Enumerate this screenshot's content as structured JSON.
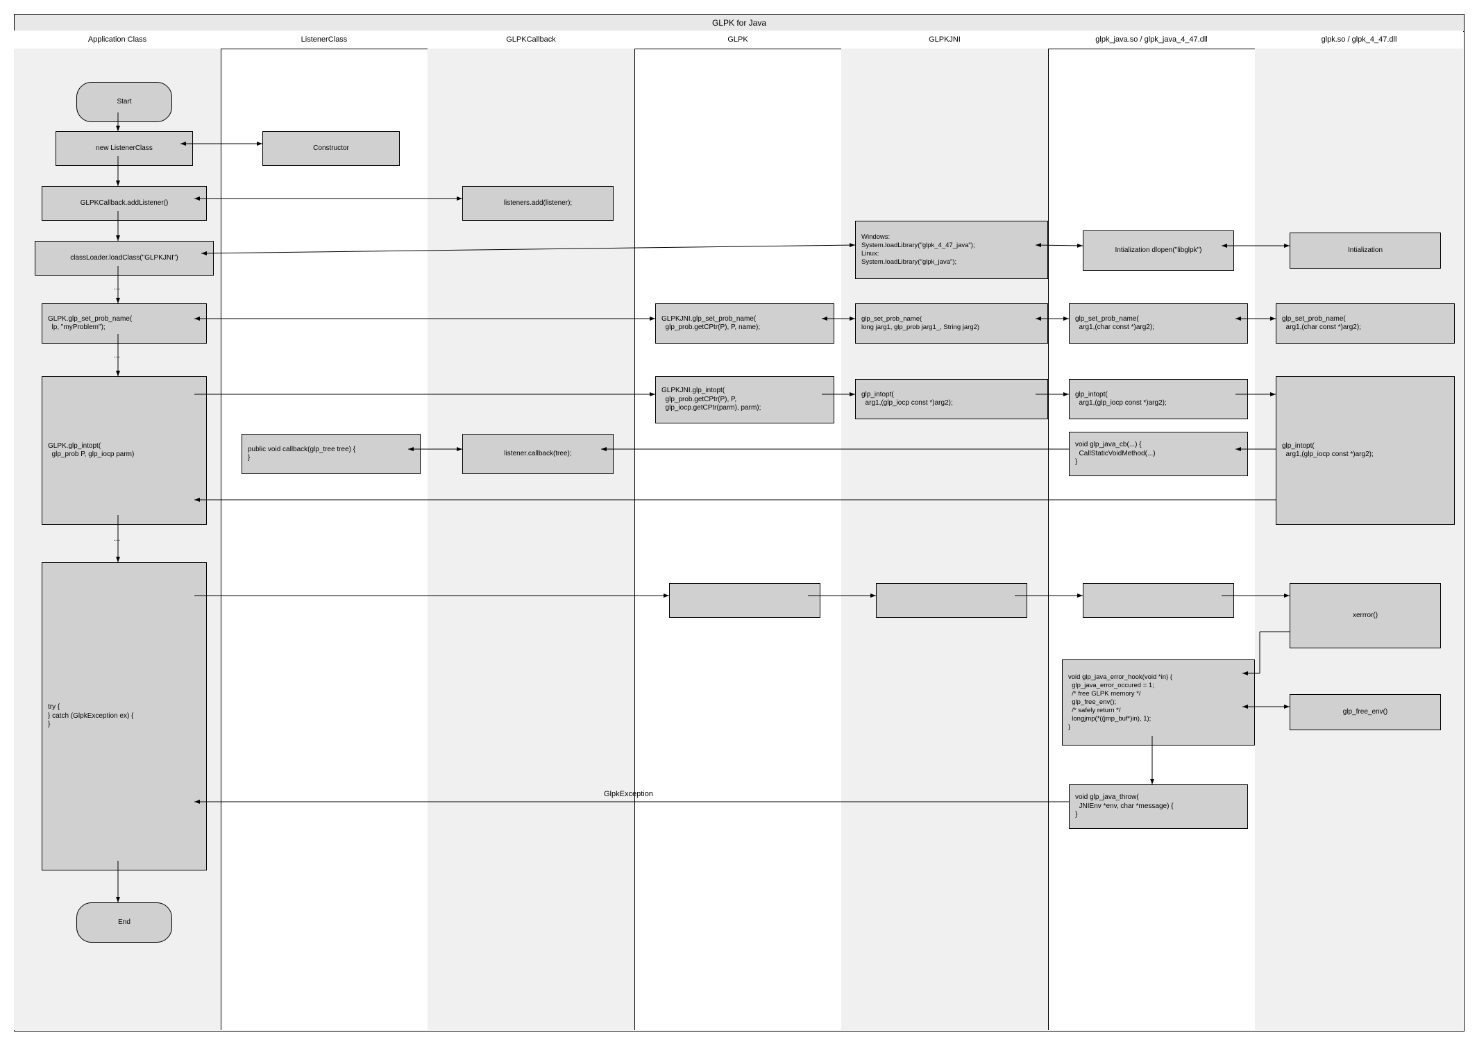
{
  "title": "GLPK for Java",
  "lanes": [
    "Application Class",
    "ListenerClass",
    "GLPKCallback",
    "GLPK",
    "GLPKJNI",
    "glpk_java.so / glpk_java_4_47.dll",
    "glpk.so / glpk_4_47.dll"
  ],
  "nodes": {
    "start": "Start",
    "newListener": "new ListenerClass",
    "constructor": "Constructor",
    "addListener": "GLPKCallback.addListener()",
    "listenersAdd": "listeners.add(listener);",
    "loadClass": "classLoader.loadClass(\"GLPKJNI\")",
    "jniLoad": "Windows:\nSystem.loadLibrary(\"glpk_4_47_java\");\nLinux:\nSystem.loadLibrary(\"glpk_java\");",
    "initA": "Intialization\ndlopen(\"libglpk\")",
    "initB": "Intialization",
    "setProbApp": "GLPK.glp_set_prob_name(\n  lp, \"myProblem\");",
    "setProbGlpk": "GLPKJNI.glp_set_prob_name(\n  glp_prob.getCPtr(P), P, name);",
    "setProbJni": "glp_set_prob_name(\nlong jarg1, glp_prob jarg1_, String jarg2)",
    "setProbSoA": "glp_set_prob_name(\n  arg1,(char const *)arg2);",
    "setProbSoB": "glp_set_prob_name(\n  arg1,(char const *)arg2);",
    "intoptApp": "GLPK.glp_intopt(\n  glp_prob P, glp_iocp parm)",
    "intoptGlpk": "GLPKJNI.glp_intopt(\n  glp_prob.getCPtr(P), P,\n  glp_iocp.getCPtr(parm), parm);",
    "intoptJni": "glp_intopt(\n  arg1,(glp_iocp const *)arg2);",
    "intoptSoA": "glp_intopt(\n  arg1,(glp_iocp const *)arg2);",
    "intoptSoB": "glp_intopt(\n  arg1,(glp_iocp const *)arg2);",
    "listenerCb": "public void callback(glp_tree tree) {\n}",
    "callbackCb": "listener.callback(tree);",
    "javaCb": "void glp_java_cb(...) {\n  CallStaticVoidMethod(...)\n}",
    "tryCatch": "try {\n} catch (GlpkException ex) {\n}",
    "xerror": "xerrror()",
    "errorHook": "void glp_java_error_hook(void *in) {\n  glp_java_error_occured = 1;\n  /* free GLPK memory */\n  glp_free_env();\n  /* safely return */\n  longjmp(*((jmp_buf*)in), 1);\n}",
    "freeEnv": "glp_free_env()",
    "javaThrow": "void glp_java_throw(\n  JNIEnv *env, char *message) {\n}",
    "end": "End",
    "dots": "...",
    "glpkException": "GlpkException"
  },
  "chart_data": {
    "type": "swimlane-flowchart",
    "title": "GLPK for Java",
    "lanes": [
      "Application Class",
      "ListenerClass",
      "GLPKCallback",
      "GLPK",
      "GLPKJNI",
      "glpk_java.so / glpk_java_4_47.dll",
      "glpk.so / glpk_4_47.dll"
    ],
    "nodes": [
      {
        "id": "start",
        "lane": 0,
        "kind": "terminator",
        "text": "Start"
      },
      {
        "id": "newListener",
        "lane": 0,
        "kind": "process",
        "text": "new ListenerClass"
      },
      {
        "id": "constructor",
        "lane": 1,
        "kind": "process",
        "text": "Constructor"
      },
      {
        "id": "addListener",
        "lane": 0,
        "kind": "process",
        "text": "GLPKCallback.addListener()"
      },
      {
        "id": "listenersAdd",
        "lane": 2,
        "kind": "process",
        "text": "listeners.add(listener);"
      },
      {
        "id": "loadClass",
        "lane": 0,
        "kind": "process",
        "text": "classLoader.loadClass(\"GLPKJNI\")"
      },
      {
        "id": "jniLoad",
        "lane": 4,
        "kind": "process",
        "text": "Windows:\nSystem.loadLibrary(\"glpk_4_47_java\");\nLinux:\nSystem.loadLibrary(\"glpk_java\");"
      },
      {
        "id": "initA",
        "lane": 5,
        "kind": "process",
        "text": "Intialization\ndlopen(\"libglpk\")"
      },
      {
        "id": "initB",
        "lane": 6,
        "kind": "process",
        "text": "Intialization"
      },
      {
        "id": "setProbApp",
        "lane": 0,
        "kind": "process",
        "text": "GLPK.glp_set_prob_name(lp, \"myProblem\");"
      },
      {
        "id": "setProbGlpk",
        "lane": 3,
        "kind": "process",
        "text": "GLPKJNI.glp_set_prob_name(glp_prob.getCPtr(P), P, name);"
      },
      {
        "id": "setProbJni",
        "lane": 4,
        "kind": "process",
        "text": "glp_set_prob_name(long jarg1, glp_prob jarg1_, String jarg2)"
      },
      {
        "id": "setProbSoA",
        "lane": 5,
        "kind": "process",
        "text": "glp_set_prob_name(arg1,(char const *)arg2);"
      },
      {
        "id": "setProbSoB",
        "lane": 6,
        "kind": "process",
        "text": "glp_set_prob_name(arg1,(char const *)arg2);"
      },
      {
        "id": "intoptApp",
        "lane": 0,
        "kind": "process",
        "text": "GLPK.glp_intopt(glp_prob P, glp_iocp parm)"
      },
      {
        "id": "intoptGlpk",
        "lane": 3,
        "kind": "process",
        "text": "GLPKJNI.glp_intopt(glp_prob.getCPtr(P), P, glp_iocp.getCPtr(parm), parm);"
      },
      {
        "id": "intoptJni",
        "lane": 4,
        "kind": "process",
        "text": "glp_intopt(arg1,(glp_iocp const *)arg2);"
      },
      {
        "id": "intoptSoA",
        "lane": 5,
        "kind": "process",
        "text": "glp_intopt(arg1,(glp_iocp const *)arg2);"
      },
      {
        "id": "intoptSoB",
        "lane": 6,
        "kind": "process",
        "text": "glp_intopt(arg1,(glp_iocp const *)arg2);"
      },
      {
        "id": "listenerCb",
        "lane": 1,
        "kind": "process",
        "text": "public void callback(glp_tree tree) { }"
      },
      {
        "id": "callbackCb",
        "lane": 2,
        "kind": "process",
        "text": "listener.callback(tree);"
      },
      {
        "id": "javaCb",
        "lane": 5,
        "kind": "process",
        "text": "void glp_java_cb(...) { CallStaticVoidMethod(...) }"
      },
      {
        "id": "tryCatch",
        "lane": 0,
        "kind": "process",
        "text": "try { } catch (GlpkException ex) { }"
      },
      {
        "id": "emptyGlpk",
        "lane": 3,
        "kind": "process",
        "text": ""
      },
      {
        "id": "emptyJni",
        "lane": 4,
        "kind": "process",
        "text": ""
      },
      {
        "id": "emptySoA",
        "lane": 5,
        "kind": "process",
        "text": ""
      },
      {
        "id": "xerror",
        "lane": 6,
        "kind": "process",
        "text": "xerrror()"
      },
      {
        "id": "errorHook",
        "lane": 5,
        "kind": "process",
        "text": "void glp_java_error_hook(void *in) { glp_java_error_occured = 1; /* free GLPK memory */ glp_free_env(); /* safely return */ longjmp(*((jmp_buf*)in), 1); }"
      },
      {
        "id": "freeEnv",
        "lane": 6,
        "kind": "process",
        "text": "glp_free_env()"
      },
      {
        "id": "javaThrow",
        "lane": 5,
        "kind": "process",
        "text": "void glp_java_throw(JNIEnv *env, char *message) { }"
      },
      {
        "id": "end",
        "lane": 0,
        "kind": "terminator",
        "text": "End"
      }
    ],
    "edges": [
      {
        "from": "start",
        "to": "newListener",
        "dir": "uni"
      },
      {
        "from": "newListener",
        "to": "constructor",
        "dir": "bi"
      },
      {
        "from": "newListener",
        "to": "addListener",
        "dir": "uni"
      },
      {
        "from": "addListener",
        "to": "listenersAdd",
        "dir": "bi"
      },
      {
        "from": "addListener",
        "to": "loadClass",
        "dir": "uni"
      },
      {
        "from": "loadClass",
        "to": "jniLoad",
        "dir": "bi"
      },
      {
        "from": "jniLoad",
        "to": "initA",
        "dir": "bi"
      },
      {
        "from": "initA",
        "to": "initB",
        "dir": "bi"
      },
      {
        "from": "loadClass",
        "to": "setProbApp",
        "dir": "uni",
        "note": "..."
      },
      {
        "from": "setProbApp",
        "to": "setProbGlpk",
        "dir": "bi"
      },
      {
        "from": "setProbGlpk",
        "to": "setProbJni",
        "dir": "bi"
      },
      {
        "from": "setProbJni",
        "to": "setProbSoA",
        "dir": "bi"
      },
      {
        "from": "setProbSoA",
        "to": "setProbSoB",
        "dir": "bi"
      },
      {
        "from": "setProbApp",
        "to": "intoptApp",
        "dir": "uni",
        "note": "..."
      },
      {
        "from": "intoptApp",
        "to": "intoptGlpk",
        "dir": "uni"
      },
      {
        "from": "intoptGlpk",
        "to": "intoptJni",
        "dir": "uni"
      },
      {
        "from": "intoptJni",
        "to": "intoptSoA",
        "dir": "uni"
      },
      {
        "from": "intoptSoA",
        "to": "intoptSoB",
        "dir": "uni"
      },
      {
        "from": "intoptSoB",
        "to": "javaCb",
        "dir": "uni"
      },
      {
        "from": "javaCb",
        "to": "callbackCb",
        "dir": "uni"
      },
      {
        "from": "callbackCb",
        "to": "listenerCb",
        "dir": "bi"
      },
      {
        "from": "intoptSoB",
        "to": "intoptApp",
        "dir": "uni"
      },
      {
        "from": "intoptApp",
        "to": "tryCatch",
        "dir": "uni",
        "note": "..."
      },
      {
        "from": "tryCatch",
        "to": "emptyGlpk",
        "dir": "uni"
      },
      {
        "from": "emptyGlpk",
        "to": "emptyJni",
        "dir": "uni"
      },
      {
        "from": "emptyJni",
        "to": "emptySoA",
        "dir": "uni"
      },
      {
        "from": "emptySoA",
        "to": "xerror",
        "dir": "uni"
      },
      {
        "from": "xerror",
        "to": "errorHook",
        "dir": "uni"
      },
      {
        "from": "errorHook",
        "to": "freeEnv",
        "dir": "bi"
      },
      {
        "from": "errorHook",
        "to": "javaThrow",
        "dir": "uni"
      },
      {
        "from": "javaThrow",
        "to": "tryCatch",
        "dir": "uni",
        "label": "GlpkException"
      },
      {
        "from": "tryCatch",
        "to": "end",
        "dir": "uni"
      }
    ]
  }
}
